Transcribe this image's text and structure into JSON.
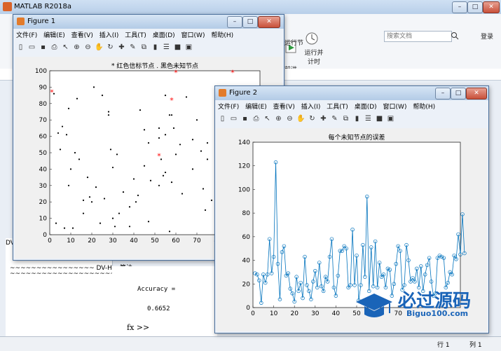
{
  "matlab": {
    "title": "MATLAB R2018a",
    "search_placeholder": "搜索文档",
    "login": "登录",
    "ribbon_run_section": "运行节",
    "ribbon_run_advance": "运行并\n计时",
    "ribbon_advance": "前进",
    "console_line": "~~~~~~~~~~~~~~~~ DV-Hop算法",
    "console_line2": "~~~~~~~~~~~~~~~~~~~~~~~~~~~~~~~",
    "accuracy_label": "Accuracy =",
    "accuracy_value": "0.6652",
    "prompt": "fx >>",
    "status_row": "行 1",
    "status_col": "列 1",
    "left_panel_label": "DV"
  },
  "figure1": {
    "title": "Figure 1",
    "menu": [
      "文件(F)",
      "编辑(E)",
      "查看(V)",
      "插入(I)",
      "工具(T)",
      "桌面(D)",
      "窗口(W)",
      "帮助(H)"
    ],
    "chart_title": "* 红色信标节点 . 黑色未知节点"
  },
  "figure2": {
    "title": "Figure 2",
    "menu": [
      "文件(F)",
      "编辑(E)",
      "查看(V)",
      "插入(I)",
      "工具(T)",
      "桌面(D)",
      "窗口(W)",
      "帮助(H)"
    ],
    "chart_title": "每个未知节点的误差"
  },
  "brand": {
    "name": "必过源码",
    "url": "Biguo100.com"
  },
  "colors": {
    "line": "#0072bd",
    "anchor": "#ff0000",
    "unknown": "#000000"
  },
  "chart_data": [
    {
      "type": "scatter",
      "title": "* 红色信标节点 . 黑色未知节点",
      "xlim": [
        0,
        100
      ],
      "ylim": [
        0,
        100
      ],
      "xticks": [
        0,
        10,
        20,
        30,
        40,
        50,
        60,
        70,
        80
      ],
      "yticks": [
        0,
        10,
        20,
        30,
        40,
        50,
        60,
        70,
        80,
        90,
        100
      ],
      "series": [
        {
          "name": "红色信标节点",
          "x": [
            1,
            60,
            87,
            52,
            58
          ],
          "y": [
            87,
            99,
            99,
            48,
            82
          ]
        },
        {
          "name": "黑色未知节点",
          "x": [
            4,
            2,
            6,
            8,
            9,
            13,
            21,
            25,
            28,
            28,
            30,
            32,
            43,
            45,
            47,
            52,
            55,
            55,
            57,
            59,
            45,
            52,
            62,
            65,
            68,
            70,
            75,
            83,
            88,
            3,
            9,
            10,
            14,
            16,
            19,
            22,
            30,
            33,
            38,
            41,
            52,
            55,
            58,
            63,
            73,
            74,
            77,
            5,
            7,
            12,
            16,
            18,
            26,
            29,
            35,
            42,
            48,
            53,
            58,
            68,
            75,
            11,
            24,
            31,
            38,
            47,
            54,
            60,
            72,
            79,
            85,
            20,
            40,
            57
          ],
          "y": [
            62,
            86,
            66,
            61,
            77,
            83,
            90,
            85,
            73,
            75,
            41,
            49,
            76,
            64,
            56,
            59,
            61,
            85,
            73,
            65,
            42,
            65,
            55,
            84,
            40,
            70,
            56,
            76,
            72,
            7,
            30,
            40,
            46,
            21,
            23,
            29,
            10,
            13,
            17,
            20,
            30,
            38,
            32,
            25,
            28,
            15,
            21,
            52,
            4,
            50,
            13,
            35,
            22,
            52,
            26,
            24,
            33,
            46,
            73,
            58,
            46,
            4,
            7,
            5,
            5,
            8,
            36,
            49,
            51,
            12,
            46,
            20,
            34,
            2
          ]
        }
      ]
    },
    {
      "type": "line",
      "title": "每个未知节点的误差",
      "xlim": [
        0,
        100
      ],
      "ylim": [
        0,
        140
      ],
      "xticks": [
        0,
        10,
        20,
        30,
        40,
        50,
        60,
        70
      ],
      "yticks": [
        0,
        20,
        40,
        60,
        80,
        100,
        120,
        140
      ],
      "series": [
        {
          "name": "",
          "values": [
            29,
            28,
            23,
            4,
            28,
            21,
            28,
            58,
            29,
            43,
            123,
            37,
            7,
            47,
            52,
            27,
            29,
            16,
            12,
            5,
            26,
            14,
            21,
            8,
            43,
            19,
            14,
            7,
            22,
            31,
            17,
            38,
            18,
            14,
            26,
            22,
            43,
            58,
            17,
            10,
            27,
            48,
            48,
            52,
            50,
            17,
            19,
            66,
            19,
            44,
            6,
            19,
            53,
            26,
            94,
            14,
            51,
            18,
            56,
            17,
            38,
            26,
            28,
            17,
            33,
            32,
            10,
            20,
            37,
            52,
            48,
            15,
            19,
            53,
            40,
            22,
            25,
            22,
            33,
            17,
            35,
            14,
            28,
            36,
            42,
            22,
            10,
            12,
            42,
            44,
            43,
            42,
            17,
            21,
            30,
            28,
            44,
            41,
            62,
            45,
            79,
            46
          ]
        }
      ]
    }
  ]
}
